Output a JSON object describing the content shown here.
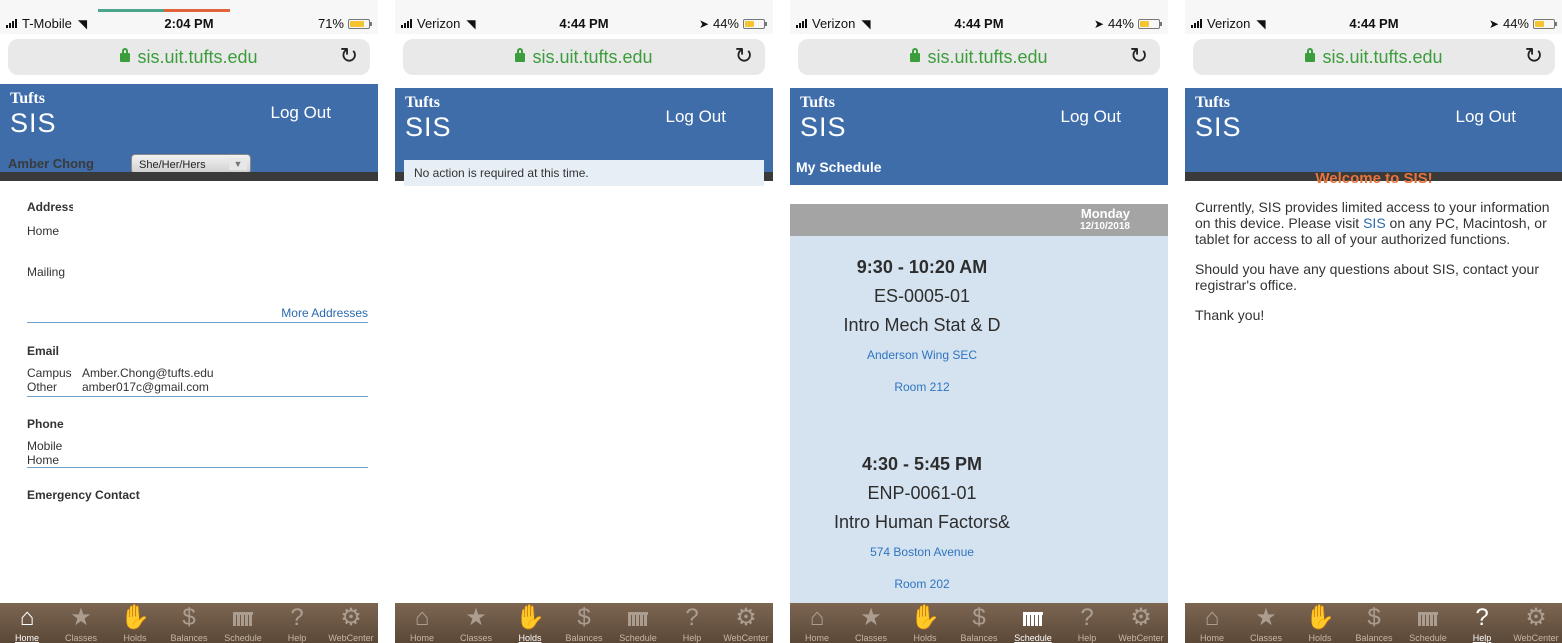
{
  "screens": [
    {
      "status": {
        "carrier": "T-Mobile",
        "time": "2:04 PM",
        "battery": "71%",
        "battery_level": 0.71,
        "location_arrow": false
      },
      "url": "sis.uit.tufts.edu",
      "header": {
        "logo_top": "Tufts",
        "logo_bottom": "SIS",
        "logout": "Log Out"
      },
      "profile": {
        "name": "Amber Chong",
        "pronoun_select": "She/Her/Hers",
        "address_title": "Address",
        "address_home": "Home",
        "address_mailing": "Mailing",
        "more_addresses": "More Addresses",
        "email_title": "Email",
        "email_campus_label": "Campus",
        "email_campus": "Amber.Chong@tufts.edu",
        "email_other_label": "Other",
        "email_other": "amber017c@gmail.com",
        "phone_title": "Phone",
        "phone_mobile": "Mobile",
        "phone_home": "Home",
        "emergency_title": "Emergency Contact"
      },
      "active_tab": "Home"
    },
    {
      "status": {
        "carrier": "Verizon",
        "time": "4:44 PM",
        "battery": "44%",
        "battery_level": 0.44,
        "location_arrow": true
      },
      "url": "sis.uit.tufts.edu",
      "header": {
        "logo_top": "Tufts",
        "logo_bottom": "SIS",
        "logout": "Log Out"
      },
      "holds_message": "No action is required at this time.",
      "active_tab": "Holds"
    },
    {
      "status": {
        "carrier": "Verizon",
        "time": "4:44 PM",
        "battery": "44%",
        "battery_level": 0.44,
        "location_arrow": true
      },
      "url": "sis.uit.tufts.edu",
      "header": {
        "logo_top": "Tufts",
        "logo_bottom": "SIS",
        "logout": "Log Out"
      },
      "schedule": {
        "title": "My Schedule",
        "day": "Monday",
        "date": "12/10/2018",
        "classes": [
          {
            "time": "9:30 - 10:20 AM",
            "code": "ES-0005-01",
            "name": "Intro Mech Stat & D",
            "building": "Anderson Wing SEC",
            "room": "Room 212"
          },
          {
            "time": "4:30 - 5:45 PM",
            "code": "ENP-0061-01",
            "name": "Intro Human Factors&",
            "building": "574 Boston Avenue",
            "room": "Room 202"
          }
        ]
      },
      "active_tab": "Schedule"
    },
    {
      "status": {
        "carrier": "Verizon",
        "time": "4:44 PM",
        "battery": "44%",
        "battery_level": 0.44,
        "location_arrow": true
      },
      "url": "sis.uit.tufts.edu",
      "header": {
        "logo_top": "Tufts",
        "logo_bottom": "SIS",
        "logout": "Log Out"
      },
      "help": {
        "welcome": "Welcome to SIS!",
        "para1_before": "Currently, SIS provides limited access to your information on this device.  Please visit ",
        "para1_link": "SIS",
        "para1_after": " on any PC, Macintosh, or tablet for access to all of your authorized functions.",
        "para2": "Should you have any questions about SIS, contact your registrar's office.",
        "para3": "Thank you!"
      },
      "active_tab": "Help"
    }
  ],
  "tabs": [
    {
      "label": "Home",
      "icon": "home-icon"
    },
    {
      "label": "Classes",
      "icon": "star-icon"
    },
    {
      "label": "Holds",
      "icon": "hand-icon"
    },
    {
      "label": "Balances",
      "icon": "dollar-icon"
    },
    {
      "label": "Schedule",
      "icon": "calendar-icon"
    },
    {
      "label": "Help",
      "icon": "question-icon"
    },
    {
      "label": "WebCenter",
      "icon": "gear-icon"
    }
  ],
  "colors": {
    "header": "#3e6daa",
    "url_green": "#3c9d3c",
    "link": "#2a6aae",
    "welcome": "#e8743b",
    "tabbar": "#6b5645",
    "schedule_bg": "#d5e3f0"
  }
}
